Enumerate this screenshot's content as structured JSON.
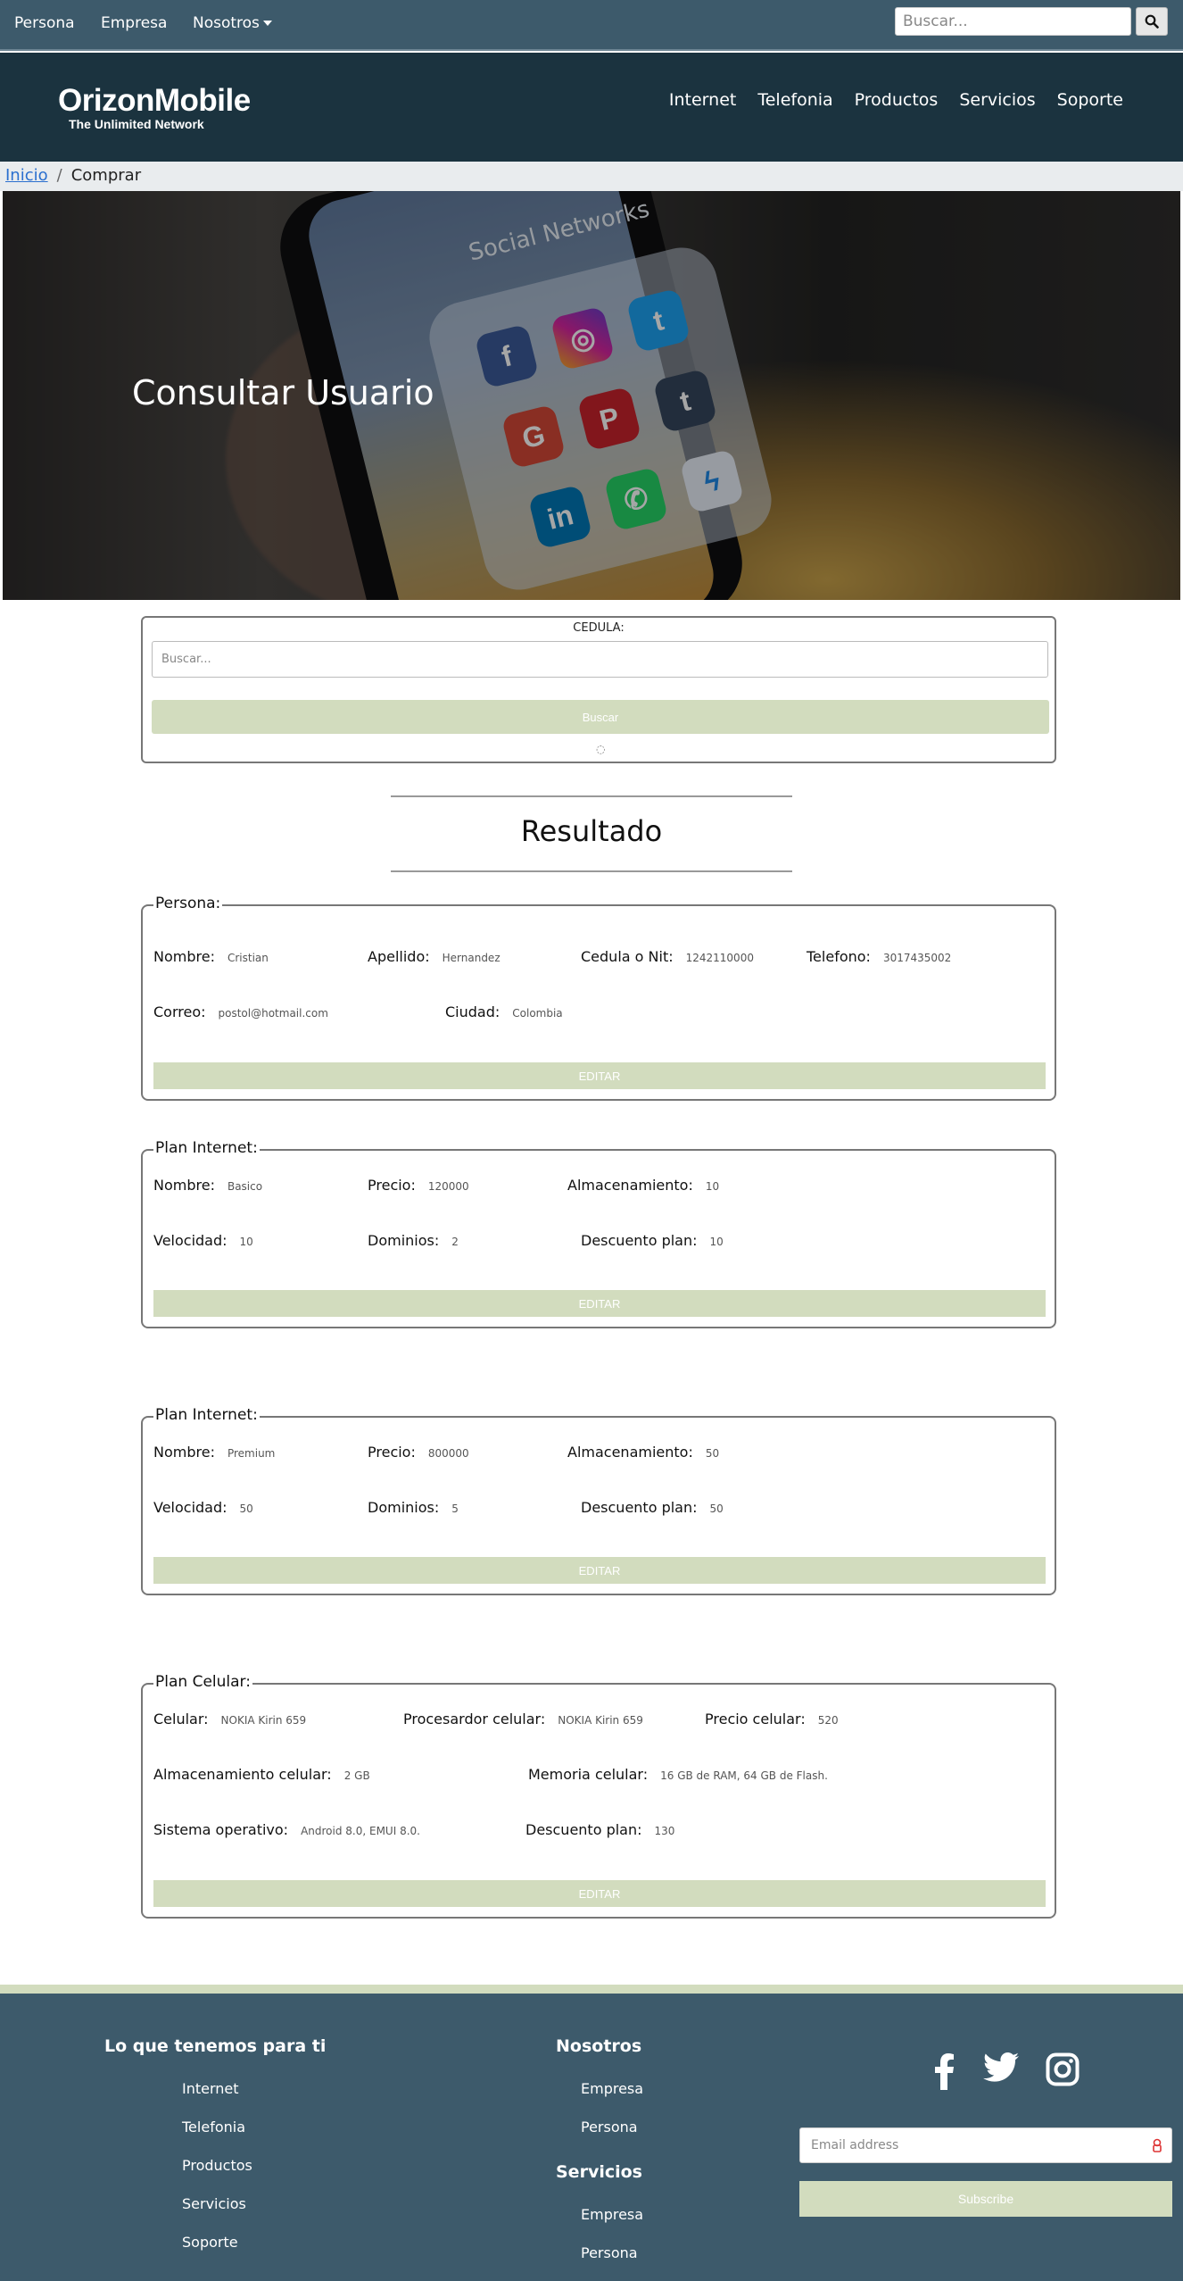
{
  "topbar": {
    "links": [
      "Persona",
      "Empresa",
      "Nosotros"
    ],
    "search_placeholder": "Buscar..."
  },
  "header": {
    "brand": "OrizonMobile",
    "tagline": "The Unlimited Network",
    "nav": [
      "Internet",
      "Telefonia",
      "Productos",
      "Servicios",
      "Soporte"
    ]
  },
  "breadcrumb": {
    "home": "Inicio",
    "sep": "/",
    "current": "Comprar"
  },
  "hero": {
    "title": "Consultar Usuario",
    "social_text": "Social Networks"
  },
  "search": {
    "label": "CEDULA:",
    "placeholder": "Buscar...",
    "button": "Buscar"
  },
  "result_title": "Resultado",
  "persona": {
    "legend": "Persona:",
    "nombre_label": "Nombre:",
    "nombre": "Cristian",
    "apellido_label": "Apellido:",
    "apellido": "Hernandez",
    "cedula_label": "Cedula o Nit:",
    "cedula": "1242110000",
    "telefono_label": "Telefono:",
    "telefono": "3017435002",
    "correo_label": "Correo:",
    "correo": "postol@hotmail.com",
    "ciudad_label": "Ciudad:",
    "ciudad": "Colombia",
    "button": "EDITAR"
  },
  "plans": [
    {
      "legend": "Plan Internet:",
      "nombre_label": "Nombre:",
      "nombre": "Basico",
      "precio_label": "Precio:",
      "precio": "120000",
      "alm_label": "Almacenamiento:",
      "alm": "10",
      "vel_label": "Velocidad:",
      "vel": "10",
      "dom_label": "Dominios:",
      "dom": "2",
      "desc_label": "Descuento plan:",
      "desc": "10",
      "button": "EDITAR"
    },
    {
      "legend": "Plan Internet:",
      "nombre_label": "Nombre:",
      "nombre": "Premium",
      "precio_label": "Precio:",
      "precio": "800000",
      "alm_label": "Almacenamiento:",
      "alm": "50",
      "vel_label": "Velocidad:",
      "vel": "50",
      "dom_label": "Dominios:",
      "dom": "5",
      "desc_label": "Descuento plan:",
      "desc": "50",
      "button": "EDITAR"
    }
  ],
  "celular": {
    "legend": "Plan Celular:",
    "cel_label": "Celular:",
    "cel": "NOKIA Kirin 659",
    "proc_label": "Procesardor celular:",
    "proc": "NOKIA Kirin 659",
    "precio_label": "Precio celular:",
    "precio": "520",
    "alm_label": "Almacenamiento celular:",
    "alm": "2 GB",
    "mem_label": "Memoria celular:",
    "mem": "16 GB de RAM, 64 GB de Flash.",
    "so_label": "Sistema operativo:",
    "so": "Android 8.0, EMUI 8.0.",
    "desc_label": "Descuento plan:",
    "desc": "130",
    "button": "EDITAR"
  },
  "footer": {
    "col1_title": "Lo que tenemos para ti",
    "col1_links": [
      "Internet",
      "Telefonia",
      "Productos",
      "Servicios",
      "Soporte"
    ],
    "col2_title": "Nosotros",
    "col2_links": [
      "Empresa",
      "Persona"
    ],
    "col3_title": "Servicios",
    "col3_links": [
      "Empresa",
      "Persona"
    ],
    "email_placeholder": "Email address",
    "subscribe": "Subscribe",
    "social_icons": [
      "facebook-icon",
      "twitter-icon",
      "instagram-icon"
    ]
  },
  "colors": {
    "topbar": "#3d5a6b",
    "header": "#1b333f",
    "button_green": "#d2dcbe",
    "link_blue": "#2a6fcf"
  }
}
